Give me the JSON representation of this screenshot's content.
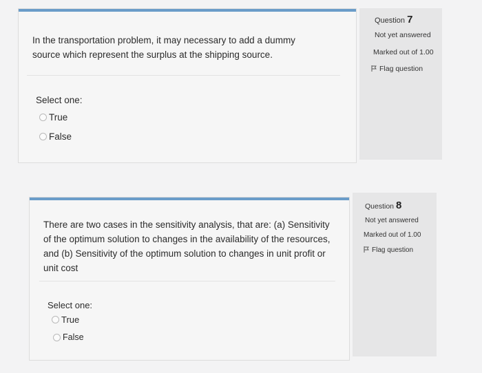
{
  "questions": [
    {
      "label": "Question",
      "number": "7",
      "status": "Not yet answered",
      "marked": "Marked out of 1.00",
      "flag": "Flag question",
      "text": "In the transportation problem, it may necessary to add a dummy source which represent the surplus at the shipping source.",
      "select_label": "Select one:",
      "options": [
        "True",
        "False"
      ]
    },
    {
      "label": "Question",
      "number": "8",
      "status": "Not yet answered",
      "marked": "Marked out of 1.00",
      "flag": "Flag question",
      "text": "There are two cases in the sensitivity analysis, that are: (a) Sensitivity of the optimum solution to changes in the availability of the resources, and (b) Sensitivity of the optimum solution to changes in unit profit or unit cost",
      "select_label": "Select one:",
      "options": [
        "True",
        "False"
      ]
    }
  ],
  "colors": {
    "accent_bar": "#6a9cc9",
    "info_panel": "#e6e6e7",
    "content_bg": "#f6f6f6"
  },
  "icons": {
    "flag": "flag-icon",
    "radio": "radio-unchecked"
  }
}
